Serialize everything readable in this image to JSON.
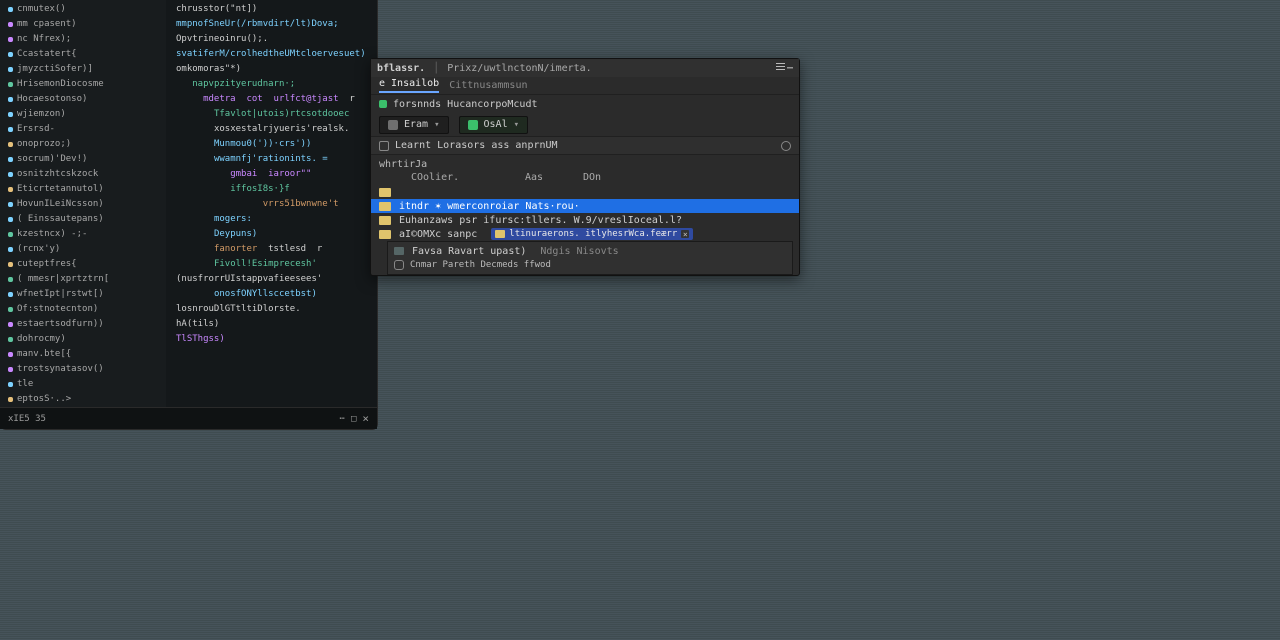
{
  "outline": {
    "items": [
      {
        "color": "#7dd2ff",
        "name": "cnmutex()"
      },
      {
        "color": "#c988ff",
        "name": "mm cpasent)"
      },
      {
        "color": "#c988ff",
        "name": "nc Nfrex);"
      },
      {
        "color": "#7dd2ff",
        "name": "Ccastatert{"
      },
      {
        "color": "#7dd2ff",
        "name": "jmyzctiSofer)]"
      },
      {
        "color": "#5fc6a0",
        "name": "HrisemonDiocosme"
      },
      {
        "color": "#7dd2ff",
        "name": "Hocaesotonso)"
      },
      {
        "color": "#7dd2ff",
        "name": "wjiemzon)"
      },
      {
        "color": "#7dd2ff",
        "name": "Ersrsd-"
      },
      {
        "color": "#e5c07b",
        "name": "onoprozo;)"
      },
      {
        "color": "#7dd2ff",
        "name": "socrum)'Dev!)"
      },
      {
        "color": "#7dd2ff",
        "name": "osnitzhtcskzock"
      },
      {
        "color": "#e5c07b",
        "name": "Eticrtetannutol)"
      },
      {
        "color": "#7dd2ff",
        "name": "HovunILeiNcsson)"
      },
      {
        "color": "#7dd2ff",
        "name": "( Einssautepans)"
      },
      {
        "color": "#5fc6a0",
        "name": "kzestncx) -;-"
      },
      {
        "color": "#7dd2ff",
        "name": "(rcnx'y)"
      },
      {
        "color": "#e5c07b",
        "name": "cuteptfres{"
      },
      {
        "color": "#5fc6a0",
        "name": "( mmesr|xprtztrn["
      },
      {
        "color": "#7dd2ff",
        "name": "wfnetIpt|rstwt[)"
      },
      {
        "color": "#5fc6a0",
        "name": "Of:stnotecnton)"
      },
      {
        "color": "#c988ff",
        "name": "estaertsodfurn))"
      },
      {
        "color": "#5fc6a0",
        "name": "dohrocmy)"
      },
      {
        "color": "#c988ff",
        "name": "manv.bte[{"
      },
      {
        "color": "#c988ff",
        "name": "trostsynatasov()"
      },
      {
        "color": "#7dd2ff",
        "name": "tle"
      },
      {
        "color": "#e5c07b",
        "name": "eptosS·..>"
      }
    ]
  },
  "editor": {
    "lines": [
      [
        [
          "id",
          "chrusstor(\"nt])"
        ]
      ],
      [
        [
          "fn",
          "mmpnofSneUr(/rbmvdirt/lt)Dova;"
        ]
      ],
      [
        [
          "id",
          "Opvtrineoinru();."
        ]
      ],
      [
        [
          "fn",
          "svatiferM/crolhedtheUMtcloervesuet)"
        ]
      ],
      [
        []
      ],
      [
        [
          "id",
          "omkomoras\"*)"
        ]
      ],
      [
        [
          "id",
          "   "
        ],
        [
          "type",
          "napvpzityerudnarn·;"
        ]
      ],
      [
        [
          "id",
          "     "
        ],
        [
          "kw",
          "mdetra  cot  urlfct@tjast"
        ],
        [
          "id",
          "  r"
        ]
      ],
      [
        [
          "id",
          "       "
        ],
        [
          "type",
          "Tfavlot|utois)rtcsotdooec"
        ]
      ],
      [
        [
          "id",
          "       "
        ],
        [
          "id",
          "xosxestalrjyueris'realsk."
        ]
      ],
      [
        [
          "id",
          "       "
        ],
        [
          "fn",
          "Munmou0('))·crs'))"
        ]
      ],
      [
        [
          "id",
          "       "
        ],
        [
          "fn",
          "wwamnfj'rationints. ="
        ]
      ],
      [
        [
          "id",
          "          "
        ],
        [
          "kw",
          "gmbai  iaroor\"\""
        ]
      ],
      [
        [
          "id",
          "          "
        ],
        [
          "type",
          "iffosI8s·}f"
        ]
      ],
      [
        [
          "id",
          "                "
        ],
        [
          "str",
          "vrrs51bwnwne't"
        ]
      ],
      [
        [
          "id",
          "       "
        ],
        [
          "fn",
          "mogers:"
        ]
      ],
      [
        [
          "id",
          "       "
        ],
        [
          "fn",
          "Deypuns)"
        ]
      ],
      [
        [
          "id",
          "       "
        ],
        [
          "str",
          "fanorter"
        ],
        [
          "id",
          "  tstlesd  r"
        ]
      ],
      [
        [
          "id",
          "       "
        ],
        [
          "type",
          "Fivoll!Esimprecesh'"
        ]
      ],
      [
        []
      ],
      [
        [
          "id",
          "(nusfrorrUIstappvafieesees'"
        ]
      ],
      [
        []
      ],
      [
        [
          "id",
          "       "
        ],
        [
          "fn",
          "onosfONYllsccetbst)"
        ]
      ],
      [
        []
      ],
      [
        [
          "id",
          "losnrouDlGTtltiDlorste."
        ]
      ],
      [
        [
          "id",
          "hA(tils)"
        ]
      ],
      [
        [
          "kw",
          "TlSThgss)"
        ]
      ]
    ]
  },
  "statusbar": {
    "left": "xIE5  35",
    "rightA": "⋯",
    "rightB": "□",
    "close": "×"
  },
  "nav": {
    "title_left": "bflassr.",
    "title_right": "Prixz/uwtlnctonN/imerta.",
    "titlewin_list": "≡",
    "titlewin_menu": "⋯",
    "tabs": {
      "t1": "e Insailob",
      "t2": "Cittnusammsun"
    },
    "path": {
      "label": "forsnnds  HucancorpoMcudt"
    },
    "buttons": {
      "close": {
        "label": "Eram",
        "chev": "▾"
      },
      "ocall": {
        "label": "OsAl",
        "chev": "▾"
      }
    },
    "sub": {
      "text": "Learnt Lorasors ass  anprnUM"
    },
    "section": "whrtirJa",
    "headers": {
      "c2": "COolier.",
      "c3": "Aas",
      "c4": "DOn"
    },
    "rows": [
      {
        "text": ""
      },
      {
        "text": "itndr   ✶ wmerconroiar Nats·rou·"
      },
      {
        "text": "Euhanzaws  psr ifursc:tllers.  W.9/vreslIoceal.l?"
      },
      {
        "text": "aI©OMXc  sanpc",
        "badge": "ltinuraerons. itlyhesrWca.feærr"
      },
      {
        "text": "Favsa Ravart upast)",
        "sub": "Ndgis Nisovts"
      },
      {
        "text": "Cnmar   Pareth   Decmeds  ffwod"
      }
    ]
  }
}
